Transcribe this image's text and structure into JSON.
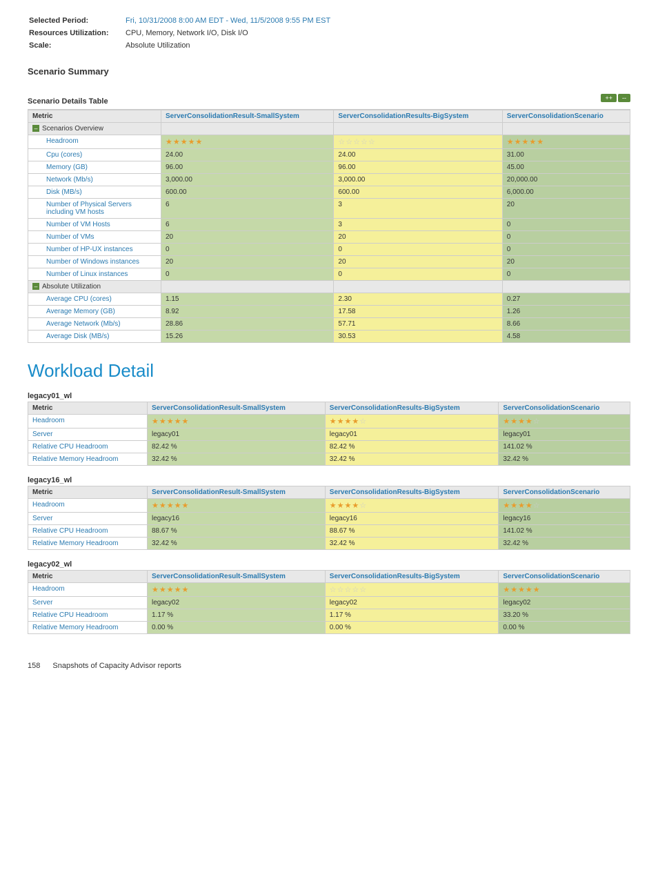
{
  "meta": {
    "selected_period_label": "Selected Period:",
    "selected_period_value": "Fri, 10/31/2008 8:00 AM EDT - Wed, 11/5/2008 9:55 PM EST",
    "resources_label": "Resources Utilization:",
    "resources_value": "CPU, Memory, Network I/O, Disk I/O",
    "scale_label": "Scale:",
    "scale_value": "Absolute Utilization"
  },
  "scenario_summary_title": "Scenario Summary",
  "scenario_table_title": "Scenario Details Table",
  "expand_all": "++",
  "collapse_all": "--",
  "columns": {
    "metric": "Metric",
    "small": "ServerConsolidationResult-SmallSystem",
    "big": "ServerConsolidationResults-BigSystem",
    "scen": "ServerConsolidationScenario"
  },
  "groups": {
    "overview": "Scenarios Overview",
    "absolute": "Absolute Utilization"
  },
  "overview_rows": [
    {
      "metric": "Headroom",
      "small_stars": 5,
      "big_stars": 0,
      "scen_stars": 5,
      "small": "",
      "big": "",
      "scen": ""
    },
    {
      "metric": "Cpu (cores)",
      "small": "24.00",
      "big": "24.00",
      "scen": "31.00"
    },
    {
      "metric": "Memory (GB)",
      "small": "96.00",
      "big": "96.00",
      "scen": "45.00"
    },
    {
      "metric": "Network (Mb/s)",
      "small": "3,000.00",
      "big": "3,000.00",
      "scen": "20,000.00"
    },
    {
      "metric": "Disk (MB/s)",
      "small": "600.00",
      "big": "600.00",
      "scen": "6,000.00"
    },
    {
      "metric": "Number of Physical Servers including VM hosts",
      "small": "6",
      "big": "3",
      "scen": "20"
    },
    {
      "metric": "Number of VM Hosts",
      "small": "6",
      "big": "3",
      "scen": "0"
    },
    {
      "metric": "Number of VMs",
      "small": "20",
      "big": "20",
      "scen": "0"
    },
    {
      "metric": "Number of HP-UX instances",
      "small": "0",
      "big": "0",
      "scen": "0"
    },
    {
      "metric": "Number of Windows instances",
      "small": "20",
      "big": "20",
      "scen": "20"
    },
    {
      "metric": "Number of Linux instances",
      "small": "0",
      "big": "0",
      "scen": "0"
    }
  ],
  "absolute_rows": [
    {
      "metric": "Average CPU (cores)",
      "small": "1.15",
      "big": "2.30",
      "scen": "0.27"
    },
    {
      "metric": "Average Memory (GB)",
      "small": "8.92",
      "big": "17.58",
      "scen": "1.26"
    },
    {
      "metric": "Average Network (Mb/s)",
      "small": "28.86",
      "big": "57.71",
      "scen": "8.66"
    },
    {
      "metric": "Average Disk (MB/s)",
      "small": "15.26",
      "big": "30.53",
      "scen": "4.58"
    }
  ],
  "workload_detail_title": "Workload Detail",
  "workloads": [
    {
      "name": "legacy01_wl",
      "rows": [
        {
          "metric": "Headroom",
          "small_stars": 5,
          "big_stars": 3,
          "scen_stars": 3,
          "half": true
        },
        {
          "metric": "Server",
          "small": "legacy01",
          "big": "legacy01",
          "scen": "legacy01"
        },
        {
          "metric": "Relative CPU Headroom",
          "small": "82.42 %",
          "big": "82.42 %",
          "scen": "141.02 %"
        },
        {
          "metric": "Relative Memory Headroom",
          "small": "32.42 %",
          "big": "32.42 %",
          "scen": "32.42 %"
        }
      ]
    },
    {
      "name": "legacy16_wl",
      "rows": [
        {
          "metric": "Headroom",
          "small_stars": 5,
          "big_stars": 3,
          "scen_stars": 3,
          "half": true
        },
        {
          "metric": "Server",
          "small": "legacy16",
          "big": "legacy16",
          "scen": "legacy16"
        },
        {
          "metric": "Relative CPU Headroom",
          "small": "88.67 %",
          "big": "88.67 %",
          "scen": "141.02 %"
        },
        {
          "metric": "Relative Memory Headroom",
          "small": "32.42 %",
          "big": "32.42 %",
          "scen": "32.42 %"
        }
      ]
    },
    {
      "name": "legacy02_wl",
      "rows": [
        {
          "metric": "Headroom",
          "small_stars": 5,
          "big_stars": 0,
          "scen_stars": 5
        },
        {
          "metric": "Server",
          "small": "legacy02",
          "big": "legacy02",
          "scen": "legacy02"
        },
        {
          "metric": "Relative CPU Headroom",
          "small": "1.17 %",
          "big": "1.17 %",
          "scen": "33.20 %"
        },
        {
          "metric": "Relative Memory Headroom",
          "small": "0.00 %",
          "big": "0.00 %",
          "scen": "0.00 %"
        }
      ]
    }
  ],
  "footer": {
    "page": "158",
    "title": "Snapshots of Capacity Advisor reports"
  },
  "chart_data": {
    "type": "table",
    "title": "Scenario Details Table",
    "columns": [
      "Metric",
      "ServerConsolidationResult-SmallSystem",
      "ServerConsolidationResults-BigSystem",
      "ServerConsolidationScenario"
    ],
    "rows": [
      [
        "Cpu (cores)",
        24.0,
        24.0,
        31.0
      ],
      [
        "Memory (GB)",
        96.0,
        96.0,
        45.0
      ],
      [
        "Network (Mb/s)",
        3000.0,
        3000.0,
        20000.0
      ],
      [
        "Disk (MB/s)",
        600.0,
        600.0,
        6000.0
      ],
      [
        "Number of Physical Servers including VM hosts",
        6,
        3,
        20
      ],
      [
        "Number of VM Hosts",
        6,
        3,
        0
      ],
      [
        "Number of VMs",
        20,
        20,
        0
      ],
      [
        "Number of HP-UX instances",
        0,
        0,
        0
      ],
      [
        "Number of Windows instances",
        20,
        20,
        20
      ],
      [
        "Number of Linux instances",
        0,
        0,
        0
      ],
      [
        "Average CPU (cores)",
        1.15,
        2.3,
        0.27
      ],
      [
        "Average Memory (GB)",
        8.92,
        17.58,
        1.26
      ],
      [
        "Average Network (Mb/s)",
        28.86,
        57.71,
        8.66
      ],
      [
        "Average Disk (MB/s)",
        15.26,
        30.53,
        4.58
      ]
    ]
  }
}
